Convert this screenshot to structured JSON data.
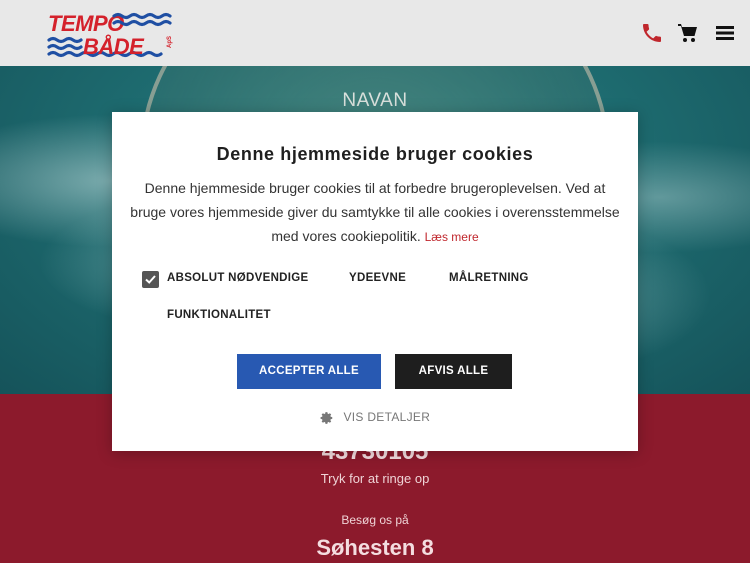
{
  "header": {
    "logo_top": "TEMPO",
    "logo_bottom": "BÅDE",
    "logo_suffix": "ApS",
    "icons": [
      "phone-icon",
      "cart-icon",
      "menu-icon"
    ],
    "brand_color": "#d4212b"
  },
  "hero": {
    "title": "NAVAN"
  },
  "contact": {
    "phone": "43730105",
    "phone_hint": "Tryk for at ringe op",
    "visit_label": "Besøg os på",
    "address": "Søhesten 8",
    "bg_color": "#8c1a2c"
  },
  "cookie_modal": {
    "title": "Denne hjemmeside bruger cookies",
    "text": "Denne hjemmeside bruger cookies til at forbedre brugeroplevelsen. Ved at bruge vores hjemmeside giver du samtykke til alle cookies i overensstemmelse med vores cookiepolitik.",
    "read_more": "Læs mere",
    "options": [
      {
        "label": "ABSOLUT NØDVENDIGE",
        "checked": true
      },
      {
        "label": "YDEEVNE",
        "checked": false
      },
      {
        "label": "MÅLRETNING",
        "checked": false
      },
      {
        "label": "FUNKTIONALITET",
        "checked": false
      }
    ],
    "accept_label": "ACCEPTER ALLE",
    "reject_label": "AFVIS ALLE",
    "details_label": "VIS DETALJER",
    "accept_color": "#2859b2",
    "reject_color": "#1e1e1e"
  }
}
